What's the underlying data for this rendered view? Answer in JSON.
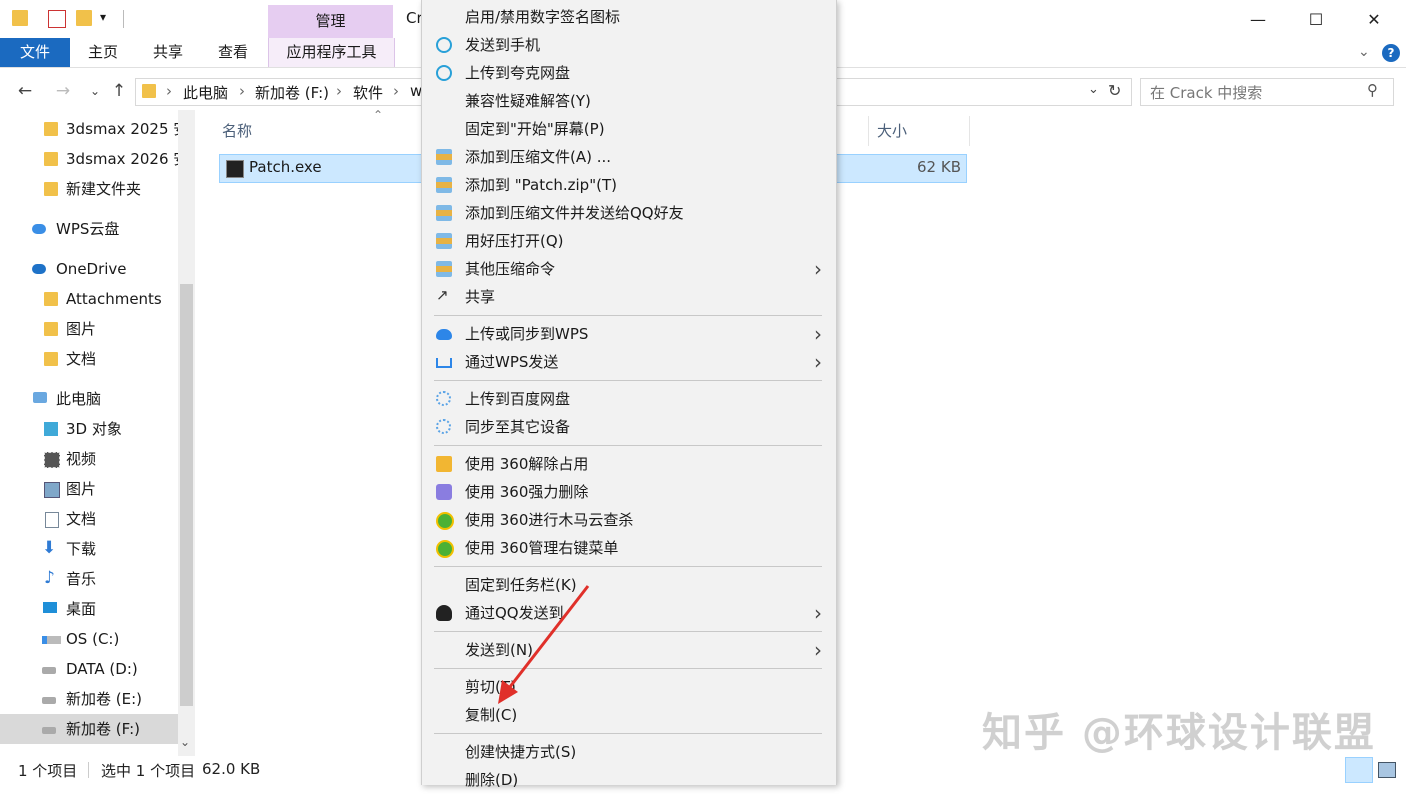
{
  "title_partial": "Cr",
  "ribbon": {
    "manage": "管理",
    "tabs": [
      "文件",
      "主页",
      "共享",
      "查看",
      "应用程序工具"
    ]
  },
  "address": {
    "crumbs": [
      "此电脑",
      "新加卷 (F:)",
      "软件",
      "w"
    ],
    "search_placeholder": "在 Crack 中搜索"
  },
  "sidebar": {
    "items": [
      {
        "label": "3dsmax 2025 安",
        "icon": "folder-icon"
      },
      {
        "label": "3dsmax 2026 安",
        "icon": "folder-icon"
      },
      {
        "label": "新建文件夹",
        "icon": "folder-icon"
      },
      {
        "label": "WPS云盘",
        "icon": "wps-cloud-icon"
      },
      {
        "label": "OneDrive",
        "icon": "onedrive-icon"
      },
      {
        "label": "Attachments",
        "icon": "folder-icon"
      },
      {
        "label": "图片",
        "icon": "folder-icon"
      },
      {
        "label": "文档",
        "icon": "folder-icon"
      },
      {
        "label": "此电脑",
        "icon": "computer-icon"
      },
      {
        "label": "3D 对象",
        "icon": "3d-objects-icon"
      },
      {
        "label": "视频",
        "icon": "video-icon"
      },
      {
        "label": "图片",
        "icon": "pictures-icon"
      },
      {
        "label": "文档",
        "icon": "documents-icon"
      },
      {
        "label": "下载",
        "icon": "download-icon"
      },
      {
        "label": "音乐",
        "icon": "music-icon"
      },
      {
        "label": "桌面",
        "icon": "desktop-icon"
      },
      {
        "label": "OS (C:)",
        "icon": "drive-icon"
      },
      {
        "label": "DATA (D:)",
        "icon": "drive-icon"
      },
      {
        "label": "新加卷 (E:)",
        "icon": "drive-icon"
      },
      {
        "label": "新加卷 (F:)",
        "icon": "drive-icon"
      }
    ]
  },
  "columns": {
    "name": "名称",
    "size": "大小"
  },
  "file": {
    "name": "Patch.exe",
    "size": "62 KB"
  },
  "status": {
    "count": "1 个项目",
    "selected": "选中 1 个项目",
    "size": "62.0 KB"
  },
  "menu": {
    "items": [
      "启用/禁用数字签名图标",
      "发送到手机",
      "上传到夸克网盘",
      "兼容性疑难解答(Y)",
      "固定到\"开始\"屏幕(P)",
      "添加到压缩文件(A) ...",
      "添加到 \"Patch.zip\"(T)",
      "添加到压缩文件并发送给QQ好友",
      "用好压打开(Q)",
      "其他压缩命令",
      "共享",
      "上传或同步到WPS",
      "通过WPS发送",
      "上传到百度网盘",
      "同步至其它设备",
      "使用 360解除占用",
      "使用 360强力删除",
      "使用 360进行木马云查杀",
      "使用 360管理右键菜单",
      "固定到任务栏(K)",
      "通过QQ发送到",
      "发送到(N)",
      "剪切(T)",
      "复制(C)",
      "创建快捷方式(S)",
      "删除(D)"
    ]
  },
  "watermark": "知乎 @环球设计联盟",
  "colors": {
    "file_tab": "#1b6ac0",
    "manage_tab": "#e6cdf1",
    "selection": "#cce8ff",
    "annotation_arrow": "#e0302a"
  }
}
